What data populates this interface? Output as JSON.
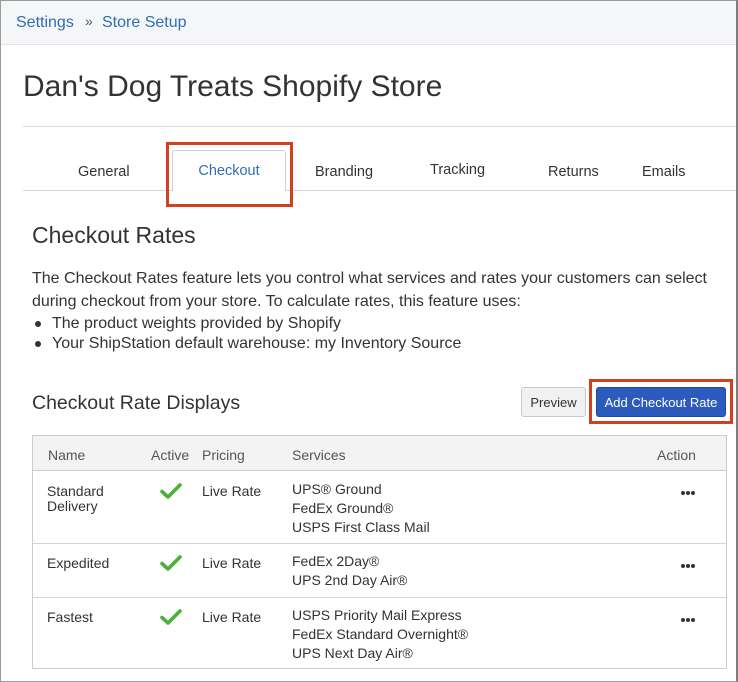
{
  "breadcrumb": {
    "settings": "Settings",
    "separator": "»",
    "store_setup": "Store Setup"
  },
  "store_title": "Dan's Dog Treats Shopify Store",
  "tabs": [
    {
      "label": "General"
    },
    {
      "label": "Checkout",
      "active": true
    },
    {
      "label": "Branding"
    },
    {
      "label": "Tracking"
    },
    {
      "label": "Returns"
    },
    {
      "label": "Emails"
    }
  ],
  "checkout_rates": {
    "title": "Checkout Rates",
    "description": "The Checkout Rates feature lets you control what services and rates your customers can select during checkout from your store. To calculate rates, this feature uses:",
    "bullets": [
      "The product weights provided by Shopify",
      "Your ShipStation default warehouse: my Inventory Source"
    ]
  },
  "displays": {
    "title": "Checkout Rate Displays",
    "preview_label": "Preview",
    "add_label": "Add Checkout Rate",
    "columns": {
      "name": "Name",
      "active": "Active",
      "pricing": "Pricing",
      "services": "Services",
      "action": "Action"
    },
    "rows": [
      {
        "name_line1": "Standard",
        "name_line2": "Delivery",
        "active": true,
        "pricing": "Live Rate",
        "services": [
          "UPS® Ground",
          "FedEx Ground®",
          "USPS First Class Mail"
        ]
      },
      {
        "name_line1": "Expedited",
        "name_line2": "",
        "active": true,
        "pricing": "Live Rate",
        "services": [
          "FedEx 2Day®",
          "UPS 2nd Day Air®"
        ]
      },
      {
        "name_line1": "Fastest",
        "name_line2": "",
        "active": true,
        "pricing": "Live Rate",
        "services": [
          "USPS Priority Mail Express",
          "FedEx Standard Overnight®",
          "UPS Next Day Air®"
        ]
      }
    ]
  },
  "icons": {
    "check": "check-icon",
    "more": "more-options-icon"
  },
  "colors": {
    "link": "#2f6db5",
    "primary_button": "#2c5bbd",
    "check": "#4caf36",
    "highlight": "#d2401f"
  }
}
